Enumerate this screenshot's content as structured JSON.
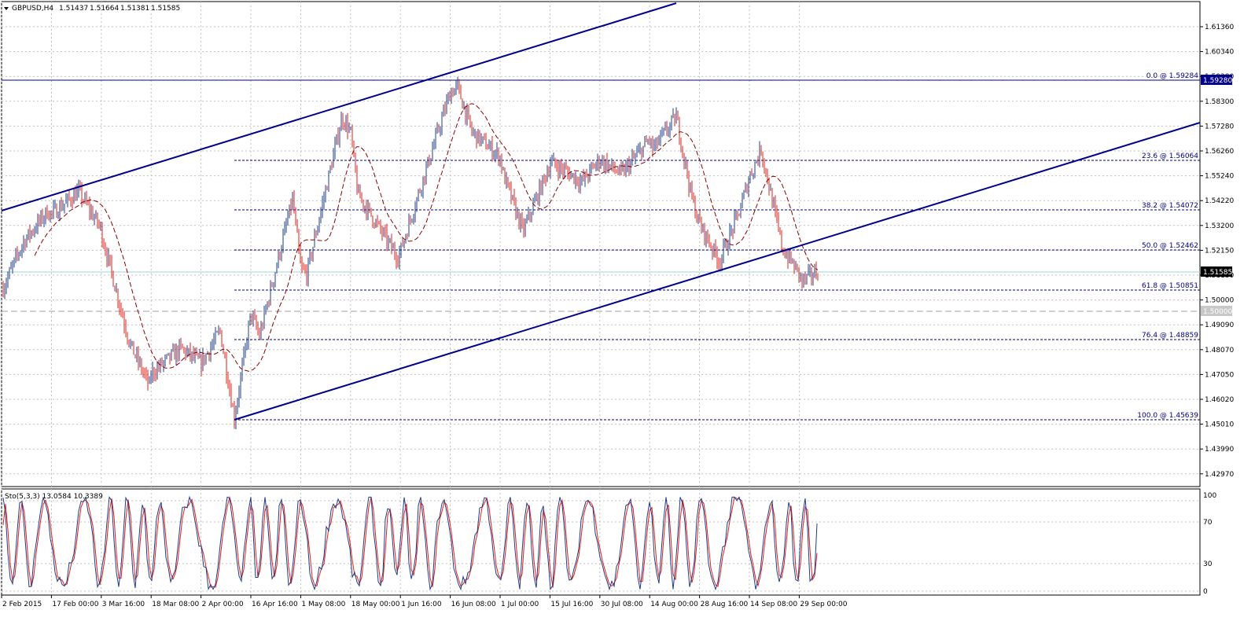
{
  "header": {
    "symbol": "GBPUSD,H4",
    "open": "1.51437",
    "high": "1.51664",
    "low": "1.51381",
    "close": "1.51585"
  },
  "colors": {
    "up_candle": "#1f3c88",
    "down_candle": "#e0201a",
    "trendline": "#00008b",
    "ma": "#8b0000",
    "grid": "#c0c0c0",
    "fib": "#000080",
    "price_tag_bg": "#000000",
    "price_tag_text": "#ffffff",
    "stoch_main": "#1f3c88",
    "stoch_signal": "#e0201a"
  },
  "price_axis": {
    "ticks": [
      "1.61360",
      "1.60340",
      "1.59280",
      "1.58300",
      "1.57280",
      "1.56260",
      "1.55240",
      "1.54220",
      "1.53200",
      "1.52150",
      "1.51130",
      "1.50000",
      "1.49090",
      "1.48070",
      "1.47050",
      "1.46020",
      "1.45010",
      "1.43990",
      "1.42970"
    ],
    "current_price": "1.51585",
    "level_1": "1.59280",
    "level_2": "1.50000"
  },
  "fibonacci": [
    {
      "label": "0.0 @ 1.59284",
      "price": 1.59284
    },
    {
      "label": "23.6 @ 1.56064",
      "price": 1.56064
    },
    {
      "label": "38.2 @ 1.54072",
      "price": 1.54072
    },
    {
      "label": "50.0 @ 1.52462",
      "price": 1.52462
    },
    {
      "label": "61.8 @ 1.50851",
      "price": 1.50851
    },
    {
      "label": "76.4 @ 1.48859",
      "price": 1.48859
    },
    {
      "label": "100.0 @ 1.45639",
      "price": 1.45639
    }
  ],
  "time_axis": [
    "2 Feb 2015",
    "17 Feb 00:00",
    "3 Mar 16:00",
    "18 Mar 08:00",
    "2 Apr 00:00",
    "16 Apr 16:00",
    "1 May 08:00",
    "18 May 00:00",
    "1 Jun 16:00",
    "16 Jun 08:00",
    "1 Jul 00:00",
    "15 Jul 16:00",
    "30 Jul 08:00",
    "14 Aug 00:00",
    "28 Aug 16:00",
    "14 Sep 08:00",
    "29 Sep 00:00"
  ],
  "stochastic": {
    "label": "Sto(5,3,3) 13.0584 10.3389",
    "ticks": [
      "100",
      "70",
      "30",
      "0"
    ]
  },
  "chart_data": {
    "type": "candlestick",
    "series_overview": [
      {
        "date": "2 Feb 2015",
        "price": 1.508
      },
      {
        "date": "17 Feb 00:00",
        "price": 1.539
      },
      {
        "date": "3 Mar 16:00",
        "price": 1.533
      },
      {
        "date": "18 Mar 08:00",
        "price": 1.475
      },
      {
        "date": "2 Apr 00:00",
        "price": 1.479
      },
      {
        "date": "16 Apr 16:00",
        "price": 1.499
      },
      {
        "date": "1 May 08:00",
        "price": 1.517
      },
      {
        "date": "18 May 00:00",
        "price": 1.572
      },
      {
        "date": "1 Jun 16:00",
        "price": 1.524
      },
      {
        "date": "16 Jun 08:00",
        "price": 1.588
      },
      {
        "date": "1 Jul 00:00",
        "price": 1.562
      },
      {
        "date": "15 Jul 16:00",
        "price": 1.559
      },
      {
        "date": "30 Jul 08:00",
        "price": 1.561
      },
      {
        "date": "14 Aug 00:00",
        "price": 1.569
      },
      {
        "date": "28 Aug 16:00",
        "price": 1.535
      },
      {
        "date": "14 Sep 08:00",
        "price": 1.554
      },
      {
        "date": "29 Sep 00:00",
        "price": 1.515
      }
    ]
  }
}
